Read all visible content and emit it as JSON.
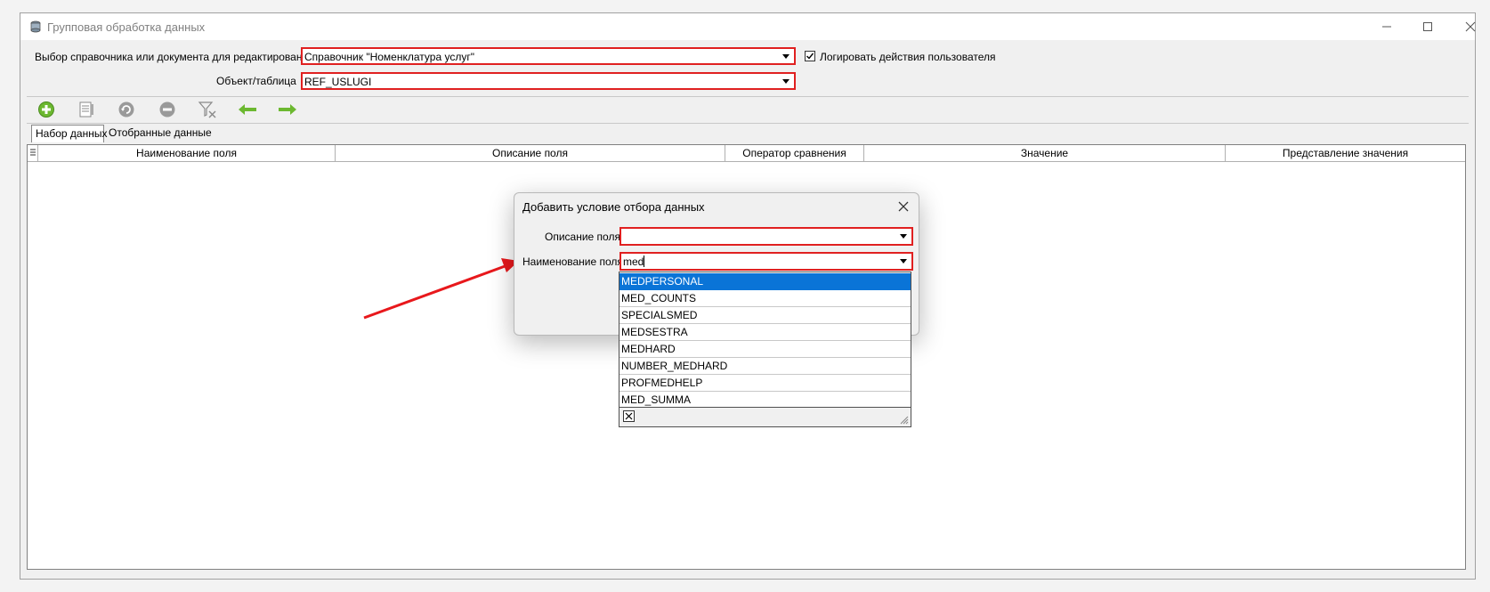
{
  "window": {
    "title": "Групповая обработка данных"
  },
  "form": {
    "source_label": "Выбор справочника или документа для редактирования",
    "source_value": "Справочник \"Номенклатура услуг\"",
    "log_label": "Логировать действия пользователя",
    "log_checked": true,
    "object_label": "Объект/таблица",
    "object_value": "REF_USLUGI"
  },
  "toolbar": {
    "buttons": [
      "add-icon",
      "edit-icon",
      "refresh-icon",
      "remove-icon",
      "clear-filter-icon",
      "arrow-left-icon",
      "arrow-right-icon"
    ]
  },
  "tabs": [
    {
      "label": "Набор данных",
      "active": true
    },
    {
      "label": "Отобранные данные",
      "active": false
    }
  ],
  "grid": {
    "columns": [
      "Наименование поля",
      "Описание поля",
      "Оператор сравнения",
      "Значение",
      "Представление значения"
    ]
  },
  "dialog": {
    "title": "Добавить условие отбора данных",
    "desc_label": "Описание поля",
    "desc_value": "",
    "name_label": "Наименование поля",
    "name_value": "med"
  },
  "dropdown": {
    "items": [
      "MEDPERSONAL",
      "MED_COUNTS",
      "SPECIALSMED",
      "MEDSESTRA",
      "MEDHARD",
      "NUMBER_MEDHARD",
      "PROFMEDHELP",
      "MED_SUMMA"
    ],
    "selected_index": 0
  },
  "colors": {
    "accent": "#0a74d7",
    "highlight_border": "#e02020",
    "arrow": "#e8181c",
    "toolbar_green": "#6cb830"
  }
}
